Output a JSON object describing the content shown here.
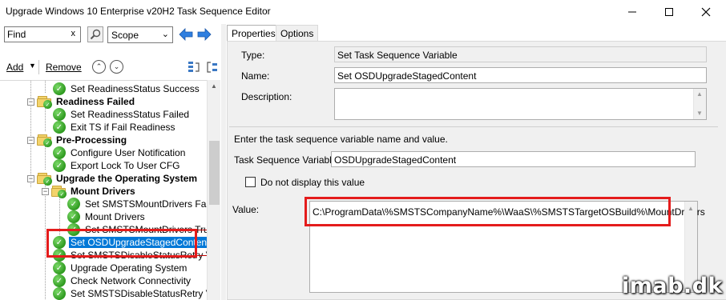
{
  "window": {
    "title": "Upgrade Windows 10 Enterprise v20H2 Task Sequence Editor",
    "controls": [
      "minimize",
      "maximize",
      "close"
    ]
  },
  "toolbar": {
    "find_value": "Find",
    "find_clear": "x",
    "scope_value": "Scope",
    "add_label": "Add",
    "remove_label": "Remove",
    "icons": [
      "search-icon",
      "arrow-left-icon",
      "arrow-right-icon",
      "move-up-icon",
      "move-down-icon",
      "group-icon",
      "ungroup-icon"
    ]
  },
  "tree": {
    "items": [
      {
        "label": "Set ReadinessStatus Success",
        "type": "step",
        "state": "normal"
      },
      {
        "label": "Readiness Failed",
        "type": "group",
        "state": "normal"
      },
      {
        "label": "Set ReadinessStatus Failed",
        "type": "step",
        "state": "normal"
      },
      {
        "label": "Exit TS if Fail Readiness",
        "type": "step",
        "state": "normal"
      },
      {
        "label": "Pre-Processing",
        "type": "group",
        "state": "normal"
      },
      {
        "label": "Configure User Notification",
        "type": "step",
        "state": "normal"
      },
      {
        "label": "Export Lock To User CFG",
        "type": "step",
        "state": "normal"
      },
      {
        "label": "Upgrade the Operating System",
        "type": "group",
        "state": "normal"
      },
      {
        "label": "Mount Drivers",
        "type": "group",
        "state": "normal"
      },
      {
        "label": "Set SMSTSMountDrivers False",
        "type": "step",
        "state": "normal"
      },
      {
        "label": "Mount Drivers",
        "type": "step",
        "state": "normal"
      },
      {
        "label": "Set SMSTSMountDrivers True",
        "type": "step",
        "state": "struck"
      },
      {
        "label": "Set OSDUpgradeStagedContent",
        "type": "step",
        "state": "selected"
      },
      {
        "label": "Set SMSTSDisableStatusRetry Value",
        "type": "step",
        "state": "struck"
      },
      {
        "label": "Upgrade Operating System",
        "type": "step",
        "state": "normal"
      },
      {
        "label": "Check Network Connectivity",
        "type": "step",
        "state": "normal"
      },
      {
        "label": "Set SMSTSDisableStatusRetry Value",
        "type": "step",
        "state": "normal"
      }
    ]
  },
  "tabs": [
    {
      "label": "Properties",
      "active": true
    },
    {
      "label": "Options",
      "active": false
    }
  ],
  "properties": {
    "type_label": "Type:",
    "type_value": "Set Task Sequence Variable",
    "name_label": "Name:",
    "name_value": "Set OSDUpgradeStagedContent",
    "description_label": "Description:",
    "description_value": "",
    "instructions": "Enter the task sequence variable name and value.",
    "variable_label": "Task Sequence Variable:",
    "variable_value": "OSDUpgradeStagedContent",
    "hide_value_label": "Do not display this value",
    "hide_value_checked": false,
    "value_label": "Value:",
    "value_value": "C:\\ProgramData\\%SMSTSCompanyName%\\WaaS\\%SMSTSTargetOSBuild%\\MountDrivers"
  },
  "watermark": "imab.dk",
  "colors": {
    "selection": "#0078d7",
    "highlight_box": "#e41c1c",
    "success_icon": "#2e9a1f",
    "folder": "#f3d36b"
  }
}
